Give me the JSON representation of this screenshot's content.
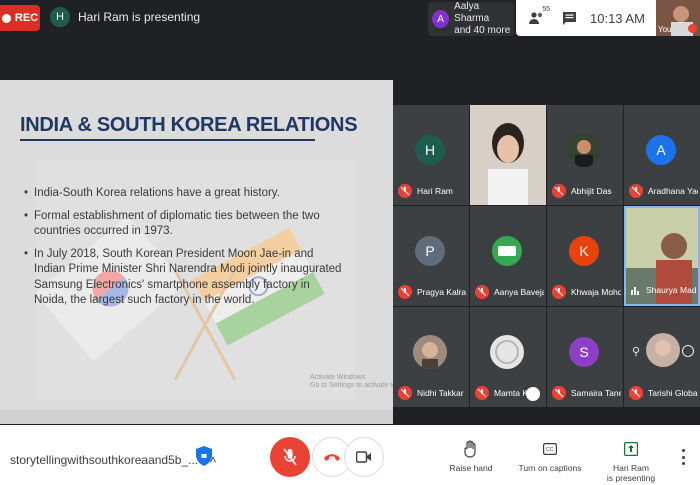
{
  "topbar": {
    "rec_label": "REC",
    "presenter_initial": "H",
    "presenter_text": "Hari Ram is presenting",
    "people_initial": "A",
    "people_line1": "Aalya Sharma",
    "people_line2": "and 40 more",
    "participants_count": "55",
    "clock": "10:13 AM",
    "self_label": "You"
  },
  "slide": {
    "title": "INDIA & SOUTH KOREA RELATIONS",
    "bullets": [
      "India-South Korea relations have a great history.",
      "Formal establishment of diplomatic ties between the two countries occurred in 1973.",
      "In July 2018, South Korean President Moon Jae-in and Indian Prime Minister Shri Narendra Modi jointly inaugurated Samsung Electronics' smartphone assembly factory in Noida, the largest such factory in the world."
    ],
    "watermark_line1": "Activate Windows",
    "watermark_line2": "Go to Settings to activate Windows."
  },
  "tiles": [
    {
      "name": "Hari Ram",
      "initial": "H",
      "color": "#1e5d4e",
      "kind": "avatar"
    },
    {
      "name": "",
      "initial": "",
      "color": "#3c4043",
      "kind": "video"
    },
    {
      "name": "Abhijit Das",
      "initial": "",
      "color": "#3c4043",
      "kind": "photo"
    },
    {
      "name": "Aradhana Yad...",
      "initial": "A",
      "color": "#1a73e8",
      "kind": "avatar"
    },
    {
      "name": "Pragya Kalra",
      "initial": "P",
      "color": "#5f6c7b",
      "kind": "avatar"
    },
    {
      "name": "Aanya Baveja",
      "initial": "",
      "color": "#34a853",
      "kind": "logo"
    },
    {
      "name": "Khwaja Mohd ...",
      "initial": "K",
      "color": "#e8430f",
      "kind": "avatar"
    },
    {
      "name": "Shaurya Mad...",
      "initial": "",
      "color": "#3c4043",
      "kind": "video2"
    },
    {
      "name": "Nidhi Takkar",
      "initial": "",
      "color": "#3c4043",
      "kind": "photo"
    },
    {
      "name": "Mamta K...",
      "initial": "",
      "color": "#3c4043",
      "kind": "photo2"
    },
    {
      "name": "Samaira Taneja",
      "initial": "S",
      "color": "#8e3fc7",
      "kind": "avatar"
    },
    {
      "name": "Tarishi Global",
      "initial": "",
      "color": "#3c4043",
      "kind": "photo3"
    }
  ],
  "bottombar": {
    "meeting_id": "storytellingwithsouthkoreaand5b_...",
    "raise_hand": "Raise hand",
    "captions": "Turn on captions",
    "presenting_line1": "Hari Ram",
    "presenting_line2": "is presenting"
  },
  "colors": {
    "accent": "#1a73e8",
    "danger": "#ea4335"
  }
}
